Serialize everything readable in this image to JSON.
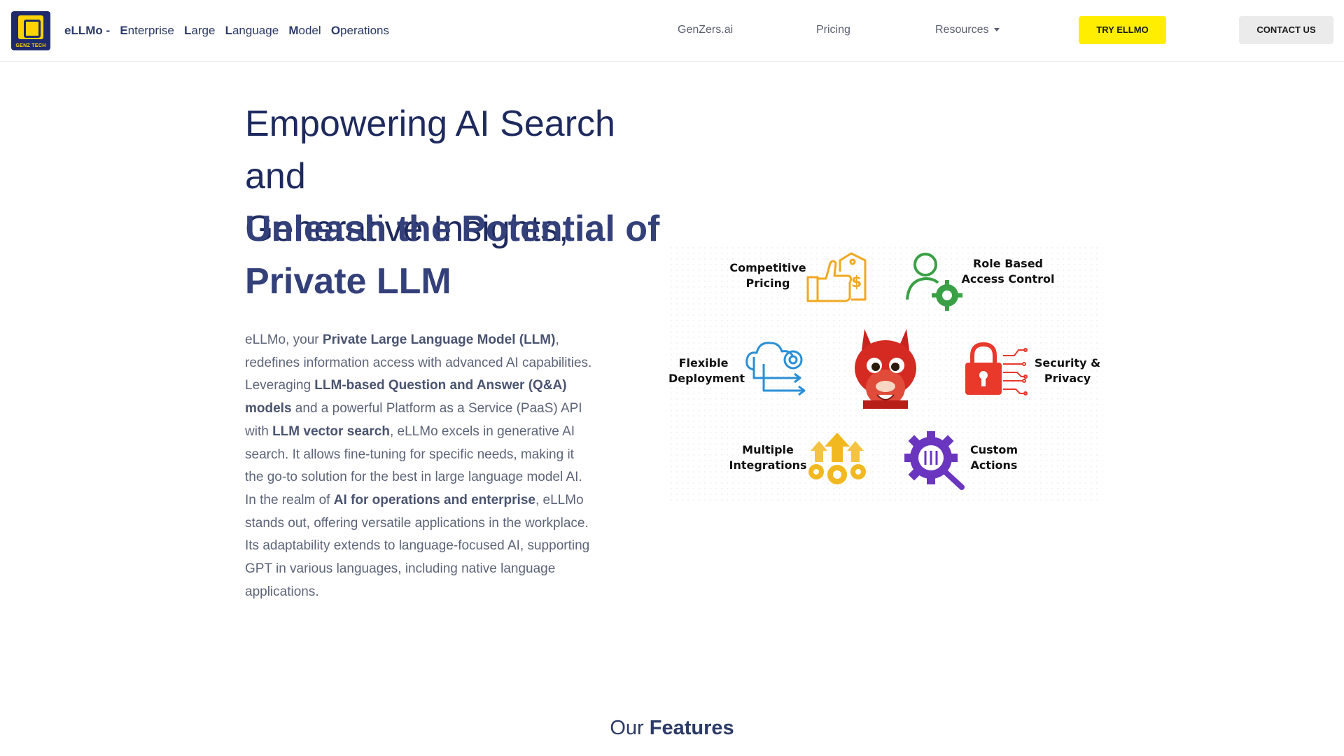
{
  "header": {
    "logo_text": "GENZ TECH",
    "brand_name": "eLLMo -",
    "brand_words": [
      {
        "cap": "E",
        "rest": "nterprise"
      },
      {
        "cap": "L",
        "rest": "arge"
      },
      {
        "cap": "L",
        "rest": "anguage"
      },
      {
        "cap": "M",
        "rest": "odel"
      },
      {
        "cap": "O",
        "rest": "perations"
      }
    ],
    "nav": {
      "genzers": "GenZers.ai",
      "pricing": "Pricing",
      "resources": "Resources"
    },
    "try_button": "TRY ELLMO",
    "contact_button": "CONTACT US"
  },
  "hero": {
    "title_line1": "Empowering AI Search and",
    "title_line2": "Generative Insights,",
    "strong_line1": "Unleash the Potential of",
    "strong_line2": "Private LLM",
    "p1_a": "eLLMo, your ",
    "p1_b": "Private Large Language Model (LLM)",
    "p1_c": ", redefines information access with advanced AI capabilities. Leveraging ",
    "p1_d": "LLM-based Question and Answer (Q&A) models",
    "p1_e": " and a powerful Platform as a Service (PaaS) API with ",
    "p1_f": "LLM vector search",
    "p1_g": ", eLLMo excels in generative AI search. It allows fine-tuning for specific needs, making it the go-to solution for the best in large language model AI.",
    "p2_a": "In the realm of ",
    "p2_b": "AI for operations and enterprise",
    "p2_c": ", eLLMo stands out, offering versatile applications in the workplace. Its adaptability extends to language-focused AI, supporting GPT in various languages, including native language applications."
  },
  "features_graphic": {
    "competitive_pricing": [
      "Competitive",
      "Pricing"
    ],
    "role_based": [
      "Role Based",
      "Access Control"
    ],
    "flexible": [
      "Flexible",
      "Deployment"
    ],
    "security": [
      "Security &",
      "Privacy"
    ],
    "integrations": [
      "Multiple",
      "Integrations"
    ],
    "custom": [
      "Custom",
      "Actions"
    ],
    "colors": {
      "pricing": "#f0a820",
      "role": "#3aa046",
      "flexible": "#2a8fd6",
      "security": "#e8392b",
      "integrations": "#f2b820",
      "custom": "#6a36c0",
      "llama": "#c8231e"
    }
  },
  "section": {
    "light": "Our ",
    "bold": "Features"
  }
}
